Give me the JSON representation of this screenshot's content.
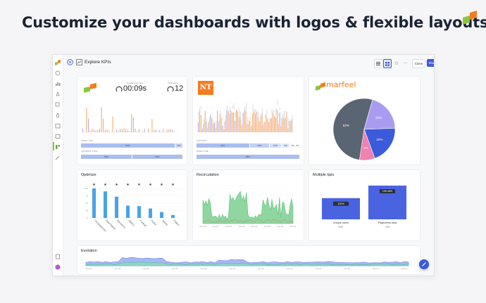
{
  "headline": "Customize your dashboards with logos & flexible layouts",
  "colors": {
    "accent": "#3b5bdb",
    "logo_orange": "#f47c20",
    "logo_green": "#8cc63f",
    "dark_slate": "#5a6573",
    "purple": "#a99cf0",
    "pink": "#f081b0",
    "blue": "#3b5bdb"
  },
  "topbar": {
    "title": "Explore KPIs",
    "clone_label": "Clone",
    "share_label": "Share"
  },
  "card_engagement": {
    "metric1_label": "Engagement time",
    "metric1_value": "00:09s",
    "metric2_label": "Total users",
    "metric2_value": "12",
    "row1_label": "PAGE TYPE",
    "row1": [
      "93%",
      "6%"
    ],
    "row2_label": "CONTENT TYPE",
    "row2": [
      "50%",
      "50%"
    ]
  },
  "card_nt": {
    "logo_text": "NT",
    "row1_label": "COUNTRY",
    "row1": [
      "52%",
      "19%",
      "12%",
      "8%",
      "5%",
      "4%"
    ],
    "row2_label": "PAGE TYPE",
    "row2": [
      "99%"
    ]
  },
  "card_marfeel": {
    "logo_text": "marfeel",
    "chart_data": {
      "type": "pie",
      "values": [
        52,
        20,
        20,
        8
      ],
      "labels": [
        "52%",
        "20%",
        "20%",
        "8%"
      ],
      "colors": [
        "#5a6573",
        "#a99cf0",
        "#3b5bdb",
        "#f081b0"
      ]
    }
  },
  "card_optimize": {
    "title": "Optimize",
    "chart_data": {
      "type": "bar",
      "categories": [
        "Uncategorized",
        "Real Madrid",
        "Barcelona",
        "Atletico",
        "Football",
        "Fútbol",
        "Sports",
        "Politics"
      ],
      "values": [
        100,
        90,
        72,
        42,
        40,
        32,
        20,
        10
      ],
      "ylim": [
        0,
        100
      ]
    }
  },
  "card_recirculation": {
    "title": "Recirculation",
    "x_ticks": [
      "Sep 30",
      "Oct 01",
      "Oct 02",
      "Oct 03",
      "Oct 04",
      "Oct 05",
      "Oct 06",
      "Oct 07"
    ]
  },
  "card_multiple": {
    "title": "Multiple kpis",
    "chart_data": {
      "type": "bar",
      "categories": [
        "Unique users",
        "Pageviews total"
      ],
      "values": [
        100,
        159
      ],
      "value_labels": [
        "100%",
        "159.48%"
      ],
      "sub_values": [
        "532",
        "759"
      ]
    }
  },
  "card_evolution": {
    "title": "Evolution",
    "x_ticks": [
      "Sep 02",
      "Oct 03",
      "Oct 04",
      "Oct 05",
      "Oct 06",
      "Oct 10",
      "Oct 11",
      "Oct 16",
      "Oct 18",
      "Oct 20",
      "Oct 23",
      "Oct 27"
    ]
  }
}
